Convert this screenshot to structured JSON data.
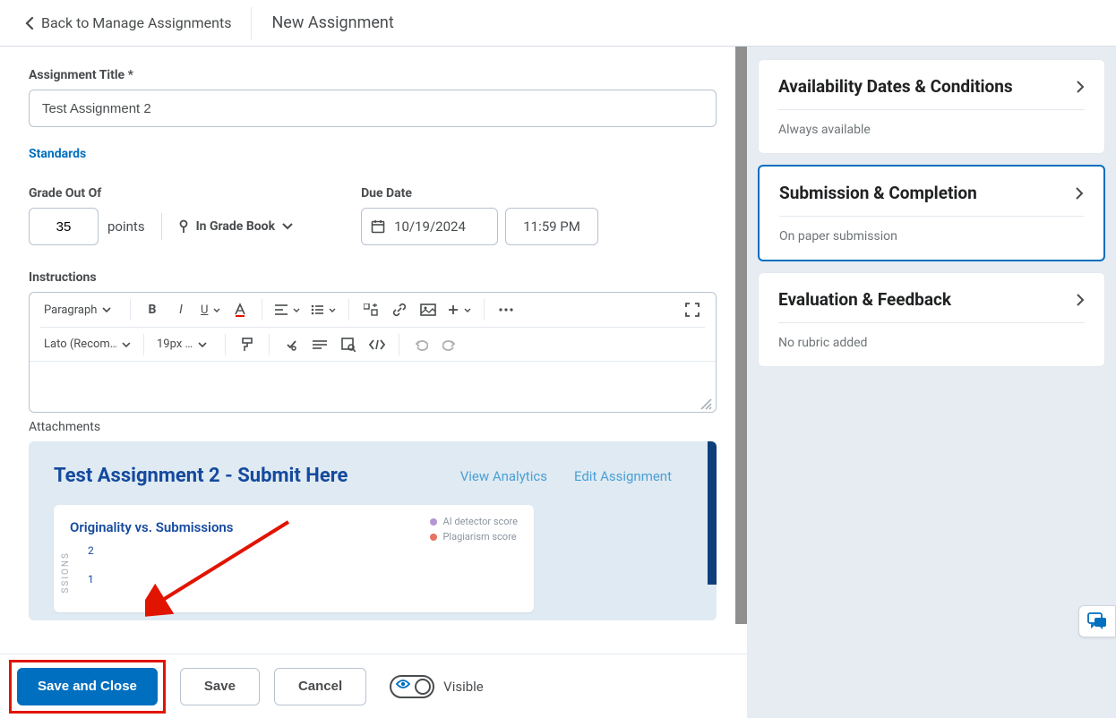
{
  "topbar": {
    "back_label": "Back to Manage Assignments",
    "title": "New Assignment"
  },
  "form": {
    "title_label": "Assignment Title *",
    "title_value": "Test Assignment 2",
    "standards_link": "Standards",
    "grade_label": "Grade Out Of",
    "grade_value": "35",
    "points_unit": "points",
    "gradebook_label": "In Grade Book",
    "due_label": "Due Date",
    "due_date": "10/19/2024",
    "due_time": "11:59 PM",
    "instructions_label": "Instructions",
    "attachments_label": "Attachments"
  },
  "editor": {
    "block_style": "Paragraph",
    "font_family": "Lato (Recom…",
    "font_size": "19px …"
  },
  "attachment": {
    "title": "Test Assignment 2 - Submit Here",
    "view_analytics": "View Analytics",
    "edit_assignment": "Edit Assignment",
    "chart_title": "Originality vs. Submissions",
    "legend_ai": "AI detector score",
    "legend_plag": "Plagiarism score",
    "y_axis_partial": "SSIONS",
    "tick2": "2",
    "tick1": "1"
  },
  "bottombar": {
    "save_close": "Save and Close",
    "save": "Save",
    "cancel": "Cancel",
    "visible": "Visible"
  },
  "panels": {
    "availability": {
      "title": "Availability Dates & Conditions",
      "sub": "Always available"
    },
    "submission": {
      "title": "Submission & Completion",
      "sub": "On paper submission"
    },
    "evaluation": {
      "title": "Evaluation & Feedback",
      "sub": "No rubric added"
    }
  },
  "chart_data": {
    "type": "scatter",
    "title": "Originality vs. Submissions",
    "ylabel": "SUBMISSIONS",
    "y_ticks_visible": [
      1,
      2
    ],
    "series": [
      {
        "name": "AI detector score",
        "color": "#b495d6",
        "values": []
      },
      {
        "name": "Plagiarism score",
        "color": "#e77362",
        "values": []
      }
    ]
  }
}
